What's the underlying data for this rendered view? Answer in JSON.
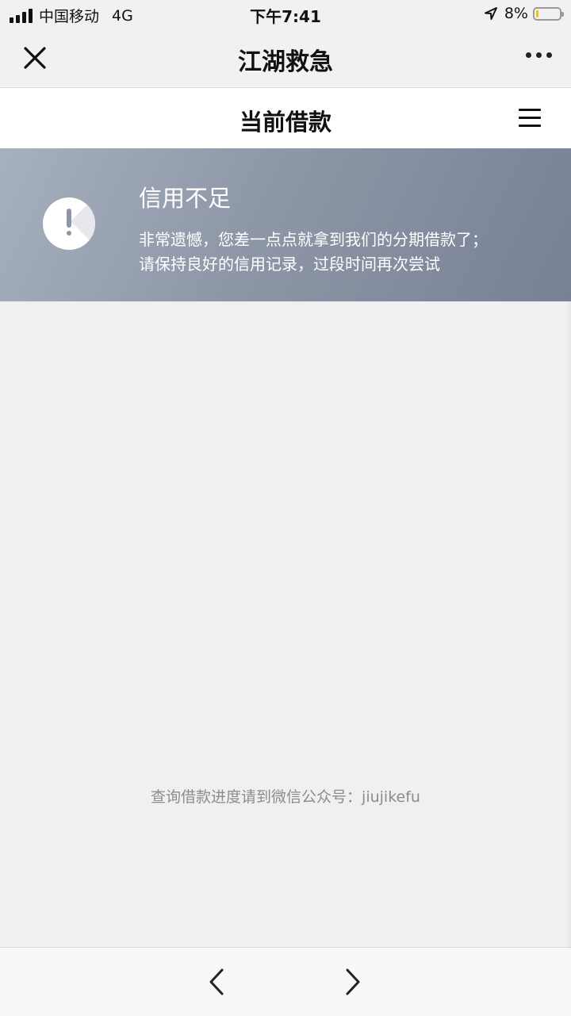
{
  "status_bar": {
    "carrier": "中国移动",
    "network": "4G",
    "time": "下午7:41",
    "battery_text": "8%",
    "battery_level": 0.08,
    "location_icon": "location-arrow-icon"
  },
  "nav": {
    "title": "江湖救急",
    "close_icon": "close-icon",
    "more_icon": "more-dots-icon"
  },
  "sub_header": {
    "title": "当前借款",
    "menu_icon": "hamburger-menu-icon"
  },
  "alert": {
    "icon": "exclamation-circle-icon",
    "title": "信用不足",
    "line1": "非常遗憾，您差一点点就拿到我们的分期借款了；",
    "line2": "请保持良好的信用记录，过段时间再次尝试"
  },
  "hint": {
    "text": "查询借款进度请到微信公众号：jiujikefu"
  },
  "bottom_nav": {
    "back_icon": "chevron-left-icon",
    "forward_icon": "chevron-right-icon"
  },
  "colors": {
    "banner_start": "#a7b0bf",
    "banner_end": "#788195",
    "battery_fill": "#f2c500",
    "background": "#f0f0f2"
  }
}
